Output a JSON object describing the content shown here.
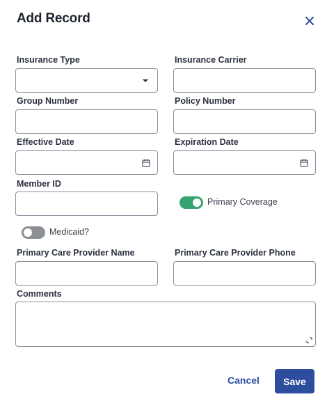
{
  "dialog": {
    "title": "Add Record",
    "close_icon": "close-icon"
  },
  "form": {
    "insurance_type": {
      "label": "Insurance Type",
      "value": ""
    },
    "insurance_carrier": {
      "label": "Insurance Carrier",
      "value": ""
    },
    "group_number": {
      "label": "Group Number",
      "value": ""
    },
    "policy_number": {
      "label": "Policy Number",
      "value": ""
    },
    "effective_date": {
      "label": "Effective Date",
      "value": ""
    },
    "expiration_date": {
      "label": "Expiration Date",
      "value": ""
    },
    "member_id": {
      "label": "Member ID",
      "value": ""
    },
    "primary_coverage": {
      "label": "Primary Coverage",
      "checked": true
    },
    "medicaid": {
      "label": "Medicaid?",
      "checked": false
    },
    "pcp_name": {
      "label": "Primary Care Provider Name",
      "value": ""
    },
    "pcp_phone": {
      "label": "Primary Care Provider Phone",
      "value": ""
    },
    "comments": {
      "label": "Comments",
      "value": ""
    }
  },
  "footer": {
    "cancel_label": "Cancel",
    "save_label": "Save"
  },
  "colors": {
    "accent": "#2d4e9e",
    "toggle_on": "#35a270",
    "toggle_off": "#8e9097",
    "border": "#8a8f9c"
  }
}
